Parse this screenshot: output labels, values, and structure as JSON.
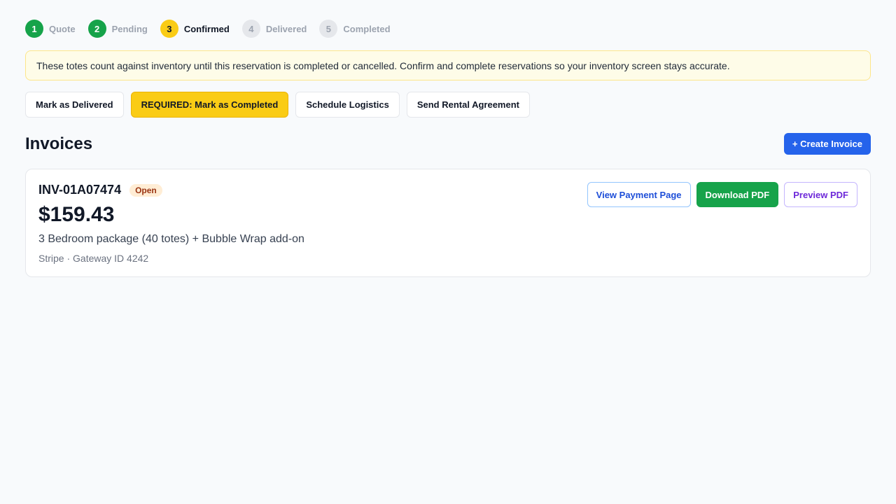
{
  "stepper": {
    "steps": [
      {
        "number": "1",
        "label": "Quote",
        "state": "done"
      },
      {
        "number": "2",
        "label": "Pending",
        "state": "done"
      },
      {
        "number": "3",
        "label": "Confirmed",
        "state": "current"
      },
      {
        "number": "4",
        "label": "Delivered",
        "state": "todo"
      },
      {
        "number": "5",
        "label": "Completed",
        "state": "todo"
      }
    ]
  },
  "notice": {
    "text": "These totes count against inventory until this reservation is completed or cancelled. Confirm and complete reservations so your inventory screen stays accurate."
  },
  "actions": {
    "mark_delivered": "Mark as Delivered",
    "mark_completed": "REQUIRED: Mark as Completed",
    "schedule_logistics": "Schedule Logistics",
    "send_agreement": "Send Rental Agreement"
  },
  "invoices": {
    "title": "Invoices",
    "create_label": "+ Create Invoice",
    "items": [
      {
        "number": "INV-01A07474",
        "status": "Open",
        "amount": "$159.43",
        "description": "3 Bedroom package (40 totes) + Bubble Wrap add-on",
        "gateway": "Stripe · Gateway ID 4242",
        "view_label": "View Payment Page",
        "download_label": "Download PDF",
        "preview_label": "Preview PDF"
      }
    ]
  },
  "colors": {
    "done": "#16a34a",
    "current": "#facc15",
    "primary": "#2563eb"
  }
}
